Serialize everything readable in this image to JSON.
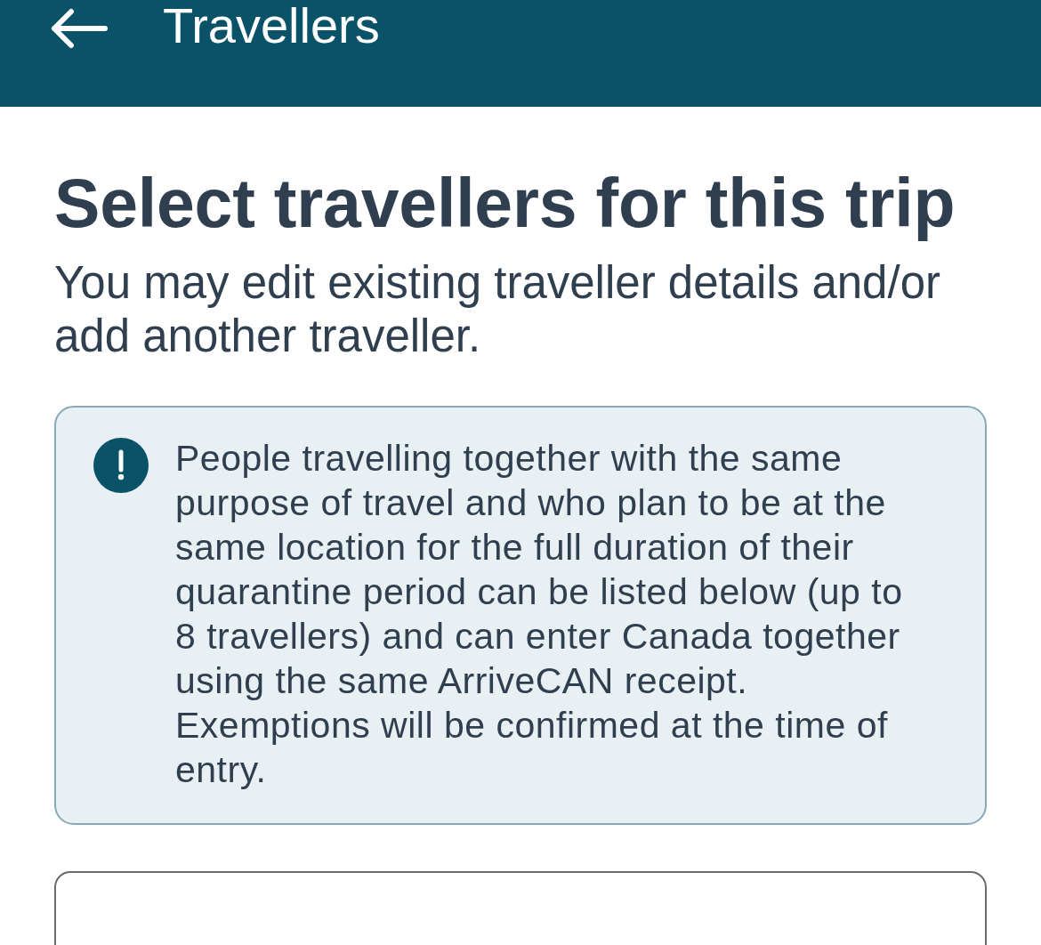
{
  "header": {
    "title": "Travellers"
  },
  "heading": "Select travellers for this trip",
  "subtitle": "You may edit existing traveller details and/or add another traveller.",
  "notice": {
    "text": "People travelling together with the same purpose of travel and who plan to be at the same location for the full duration of their quarantine period can be listed below (up to 8 travellers) and can enter Canada together using the same ArriveCAN receipt. Exemptions will be confirmed at the time of entry."
  }
}
